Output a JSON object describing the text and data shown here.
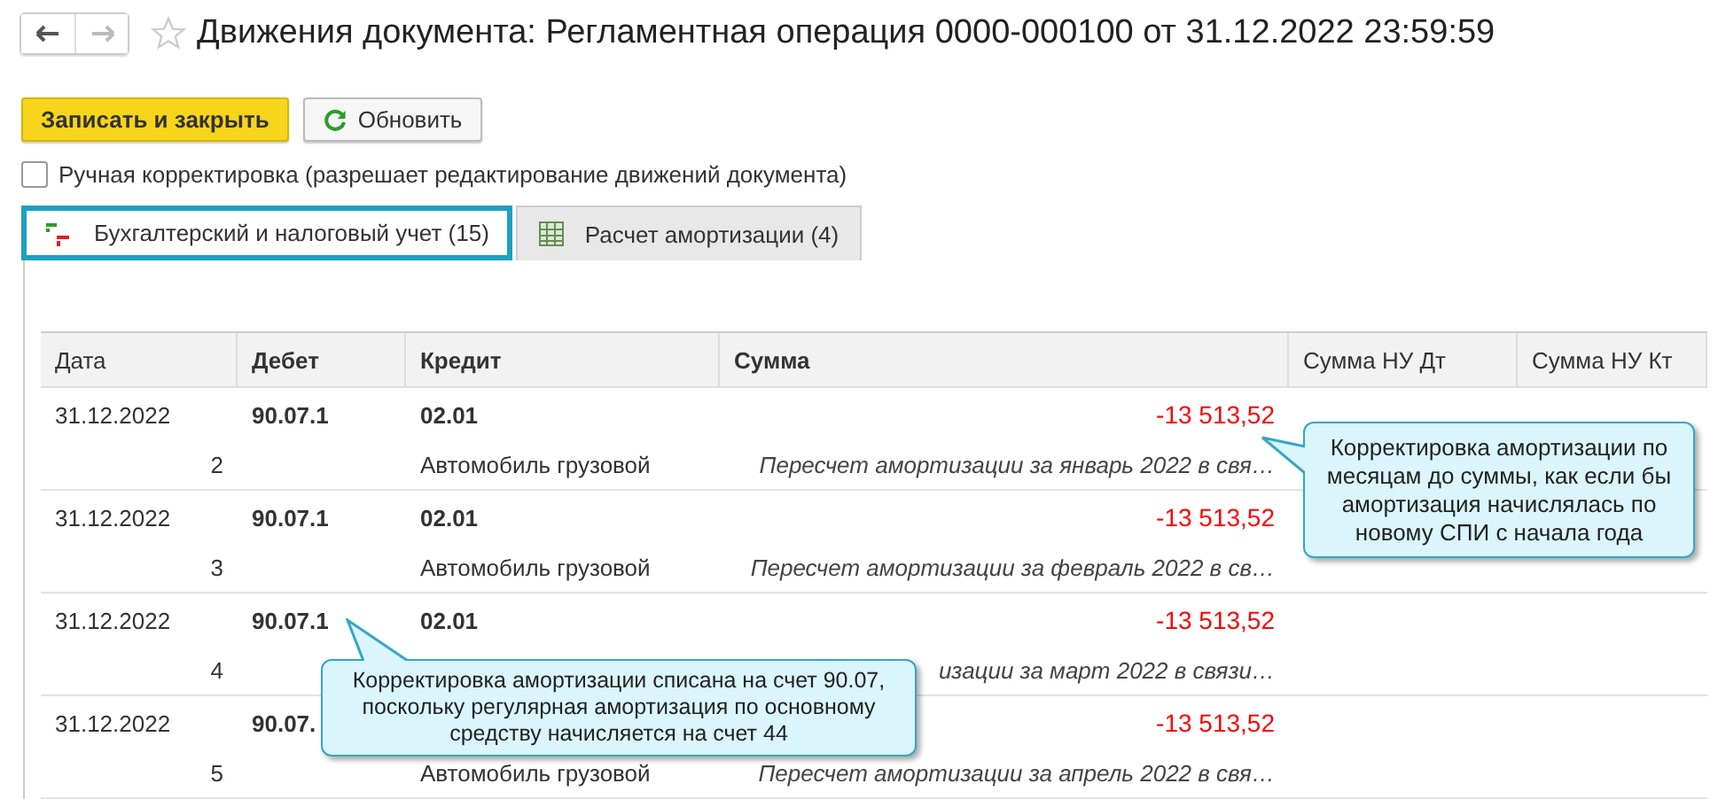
{
  "window": {
    "title": "Движения документа: Регламентная операция 0000-000100 от 31.12.2022 23:59:59",
    "favorite": false
  },
  "buttons": [
    {
      "label": "Записать и закрыть",
      "kind": "primary"
    },
    {
      "label": "Обновить",
      "kind": "refresh"
    }
  ],
  "manual_edit": {
    "label": "Ручная корректировка (разрешает редактирование движений документа)",
    "checked": false
  },
  "tabs": [
    {
      "label": "Бухгалтерский и налоговый учет (15)",
      "kind": "dtkt",
      "selected": true
    },
    {
      "label": "Расчет амортизации (4)",
      "kind": "grid",
      "selected": false
    }
  ],
  "table": {
    "columns": [
      "Дата",
      "Дебет",
      "Кредит",
      "Сумма",
      "Сумма НУ Дт",
      "Сумма НУ Кт"
    ],
    "rows": [
      {
        "date": "31.12.2022",
        "number": "2",
        "debit": "90.07.1",
        "credit": "02.01",
        "credit_sub": "Автомобиль грузовой",
        "amount": "-13 513,52",
        "description": "Пересчет амортизации за январь 2022 в свя…"
      },
      {
        "date": "31.12.2022",
        "number": "3",
        "debit": "90.07.1",
        "credit": "02.01",
        "credit_sub": "Автомобиль грузовой",
        "amount": "-13 513,52",
        "description": "Пересчет амортизации за февраль 2022 в св…"
      },
      {
        "date": "31.12.2022",
        "number": "4",
        "debit": "90.07.1",
        "credit": "02.01",
        "amount": "-13 513,52",
        "description": "изации за март 2022 в связи…"
      },
      {
        "date": "31.12.2022",
        "number": "5",
        "debit": "90.07.",
        "credit_sub": "Автомобиль грузовой",
        "amount": "-13 513,52",
        "description": "Пересчет амортизации за апрель 2022 в свя…"
      }
    ]
  },
  "callouts": [
    {
      "text": "Корректировка амортизации по месяцам до суммы, как если бы амортизация начислялась по новому СПИ с начала года"
    },
    {
      "text": "Корректировка амортизации списана на счет 90.07, поскольку регулярная амортизация по основному средству начисляется на счет 44"
    }
  ]
}
